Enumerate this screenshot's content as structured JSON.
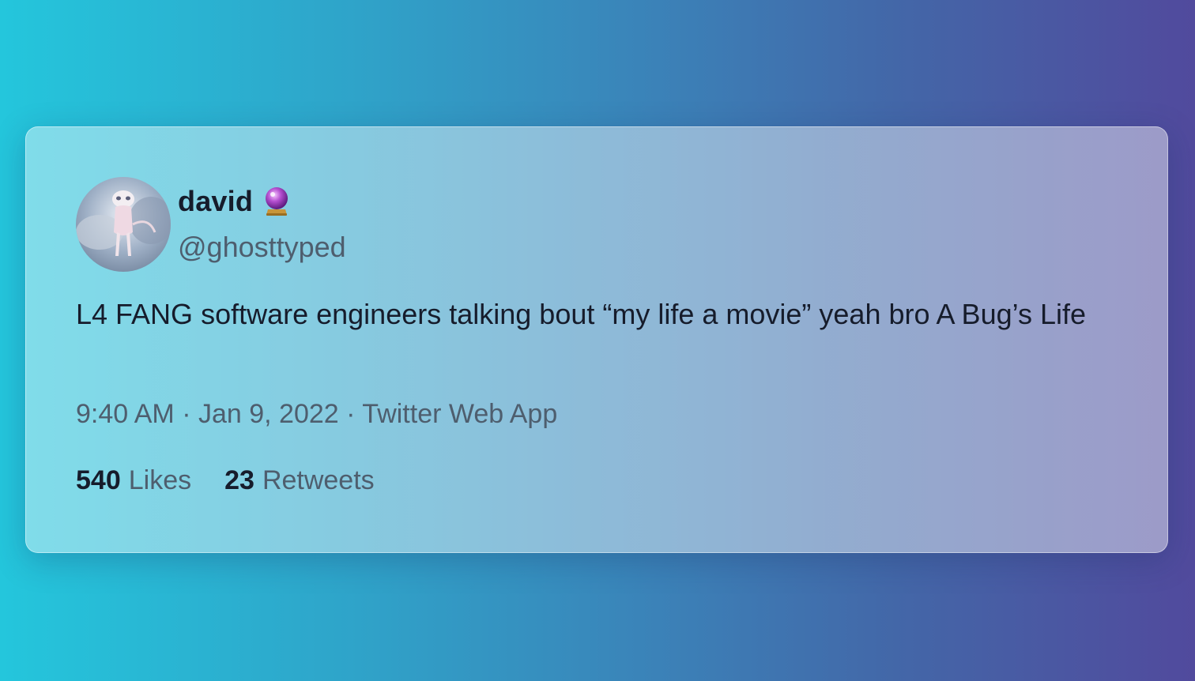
{
  "tweet": {
    "author": {
      "display_name": "david",
      "name_emoji": "crystal-ball-emoji",
      "handle": "@ghosttyped",
      "avatar": "avatar-image"
    },
    "text": "L4 FANG software engineers talking bout “my life a movie” yeah bro A Bug’s Life",
    "meta": {
      "time": "9:40 AM",
      "separator": "·",
      "date": "Jan 9, 2022",
      "source": "Twitter Web App"
    },
    "stats": {
      "likes_count": "540",
      "likes_label": "Likes",
      "retweets_count": "23",
      "retweets_label": "Retweets"
    }
  },
  "colors": {
    "background_start": "#24c6dc",
    "background_end": "#514a9d",
    "text_primary": "#161c2b",
    "text_secondary": "#4e5e6e"
  }
}
